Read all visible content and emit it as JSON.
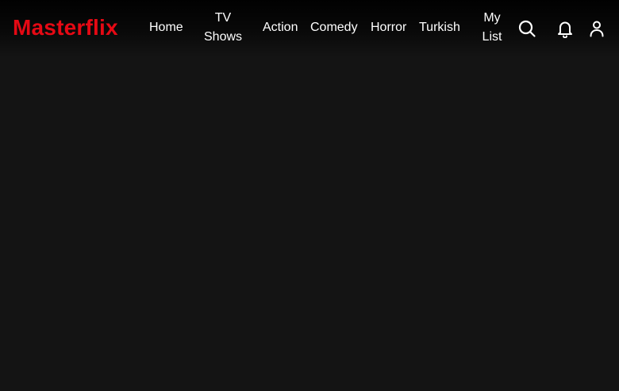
{
  "app": {
    "title": "Masterflix"
  },
  "nav": {
    "home": "Home",
    "tv_shows_line1": "TV",
    "tv_shows_line2": "Shows",
    "action": "Action",
    "comedy": "Comedy",
    "horror": "Horror",
    "turkish": "Turkish",
    "my_list_line1": "My",
    "my_list_line2": "List"
  },
  "icons": {
    "search": "search-icon",
    "notifications": "bell-icon",
    "profile": "user-icon"
  },
  "colors": {
    "brand": "#e50914",
    "background": "#141414",
    "nav_text": "#ffffff"
  }
}
